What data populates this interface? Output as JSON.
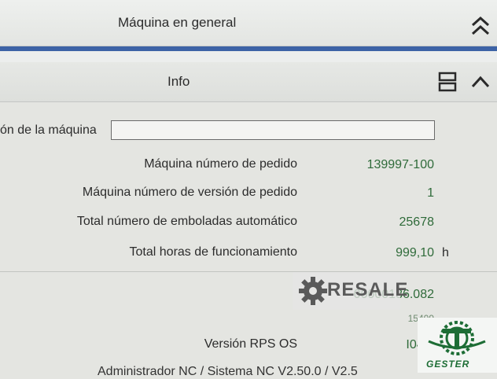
{
  "top_panel": {
    "title": "Máquina en general"
  },
  "info_panel": {
    "title": "Info"
  },
  "machine_name": {
    "label": "ón de la máquina",
    "value": ""
  },
  "rows": [
    {
      "label": "Máquina número de pedido",
      "value": "139997-100",
      "unit": ""
    },
    {
      "label": "Máquina número de versión de pedido",
      "value": "1",
      "unit": ""
    },
    {
      "label": "Total número de emboladas automático",
      "value": "25678",
      "unit": ""
    },
    {
      "label": "Total horas de funcionamiento",
      "value": "999,10",
      "unit": "h"
    }
  ],
  "lower_rows": [
    {
      "label": "",
      "value": "00000136.082"
    },
    {
      "label": "Versión RPS OS",
      "value": "I04.2"
    }
  ],
  "small_value": "15409",
  "cut_text": "Administrador NC / Sistema NC   V2.50.0 / V2.5",
  "watermark": {
    "text": "RESALE"
  },
  "logo": {
    "brand": "GESTER",
    "mark": "®"
  },
  "colors": {
    "accent_blue": "#3d63a6",
    "value_green": "#2f6b3a",
    "logo_green": "#1d6d35"
  },
  "icons": [
    "double-chevron-up-icon",
    "layout-split-icon",
    "chevron-up-icon",
    "gear-icon"
  ]
}
